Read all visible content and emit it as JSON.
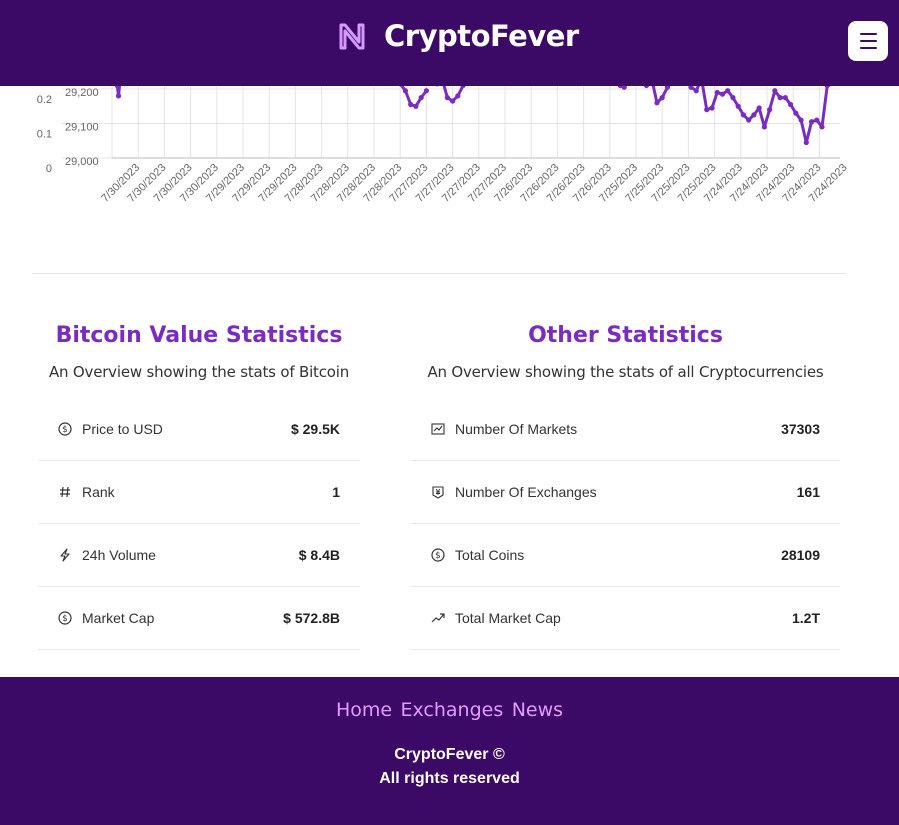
{
  "header": {
    "brand_name": "CryptoFever",
    "logo_icon": "near-protocol-logo-icon",
    "menu_icon": "hamburger-menu-icon",
    "background_color": "#3b0a66"
  },
  "chart_data": {
    "type": "line",
    "title": "",
    "xlabel": "",
    "ylabel": "",
    "left_axis_ticks": [
      "0.2",
      "0.1",
      "0"
    ],
    "right_axis_ticks": [
      "29,200",
      "29,100",
      "29,000"
    ],
    "x_tick_labels": [
      "7/30/2023",
      "7/30/2023",
      "7/30/2023",
      "7/30/2023",
      "7/29/2023",
      "7/29/2023",
      "7/29/2023",
      "7/28/2023",
      "7/28/2023",
      "7/28/2023",
      "7/28/2023",
      "7/27/2023",
      "7/27/2023",
      "7/27/2023",
      "7/27/2023",
      "7/26/2023",
      "7/26/2023",
      "7/26/2023",
      "7/26/2023",
      "7/25/2023",
      "7/25/2023",
      "7/25/2023",
      "7/25/2023",
      "7/24/2023",
      "7/24/2023",
      "7/24/2023",
      "7/24/2023",
      "7/24/2023"
    ],
    "ylim": [
      29000,
      29200
    ],
    "grid": true,
    "series_color": "#7a2cc0",
    "series": [
      {
        "x_index": [
          0.2,
          0.25,
          0.3
        ],
        "values": [
          29210,
          29180,
          29220
        ]
      },
      {
        "x_index": [
          10.8,
          11.0,
          11.2,
          11.4,
          11.6,
          11.8,
          12.0
        ],
        "values": [
          29220,
          29215,
          29195,
          29155,
          29150,
          29175,
          29195
        ]
      },
      {
        "x_index": [
          12.4,
          12.6,
          12.8,
          13.0,
          13.2,
          13.4
        ],
        "values": [
          29215,
          29230,
          29175,
          29165,
          29180,
          29210
        ]
      },
      {
        "x_index": [
          19.4,
          19.55,
          19.7
        ],
        "values": [
          29210,
          29205,
          29225
        ]
      },
      {
        "x_index": [
          20.4,
          20.6,
          20.8,
          21.0,
          21.2,
          21.4
        ],
        "values": [
          29210,
          29230,
          29160,
          29175,
          29205,
          29225
        ]
      },
      {
        "x_index": [
          22.1,
          22.3,
          22.5,
          22.7,
          22.9,
          23.1,
          23.3,
          23.5,
          23.7,
          23.9,
          24.1,
          24.3,
          24.5,
          24.7,
          24.9,
          25.1,
          25.3,
          25.5,
          25.7,
          25.9,
          26.1,
          26.3,
          26.5,
          26.7,
          26.9,
          27.1,
          27.3,
          27.5,
          27.7
        ],
        "values": [
          29205,
          29195,
          29230,
          29140,
          29145,
          29190,
          29185,
          29195,
          29175,
          29150,
          29125,
          29110,
          29125,
          29145,
          29090,
          29140,
          29195,
          29175,
          29175,
          29155,
          29130,
          29110,
          29045,
          29105,
          29110,
          29090,
          29210,
          29230,
          29240
        ]
      }
    ]
  },
  "bitcoin_stats": {
    "title": "Bitcoin Value Statistics",
    "subtitle": "An Overview showing the stats of Bitcoin",
    "rows": [
      {
        "icon": "dollar-circle-icon",
        "label": "Price to USD",
        "value": "$ 29.5K"
      },
      {
        "icon": "hash-icon",
        "label": "Rank",
        "value": "1"
      },
      {
        "icon": "lightning-icon",
        "label": "24h Volume",
        "value": "$ 8.4B"
      },
      {
        "icon": "dollar-circle-icon",
        "label": "Market Cap",
        "value": "$ 572.8B"
      }
    ]
  },
  "other_stats": {
    "title": "Other Statistics",
    "subtitle": "An Overview showing the stats of all Cryptocurrencies",
    "rows": [
      {
        "icon": "line-chart-icon",
        "label": "Number Of Markets",
        "value": "37303"
      },
      {
        "icon": "money-collect-icon",
        "label": "Number Of Exchanges",
        "value": "161"
      },
      {
        "icon": "dollar-circle-icon",
        "label": "Total Coins",
        "value": "28109"
      },
      {
        "icon": "trending-up-icon",
        "label": "Total Market Cap",
        "value": "1.2T"
      }
    ]
  },
  "footer": {
    "links": {
      "home": "Home",
      "exchanges": "Exchanges",
      "news": "News"
    },
    "copyright_line1": "CryptoFever ©",
    "copyright_line2": "All rights reserved"
  }
}
